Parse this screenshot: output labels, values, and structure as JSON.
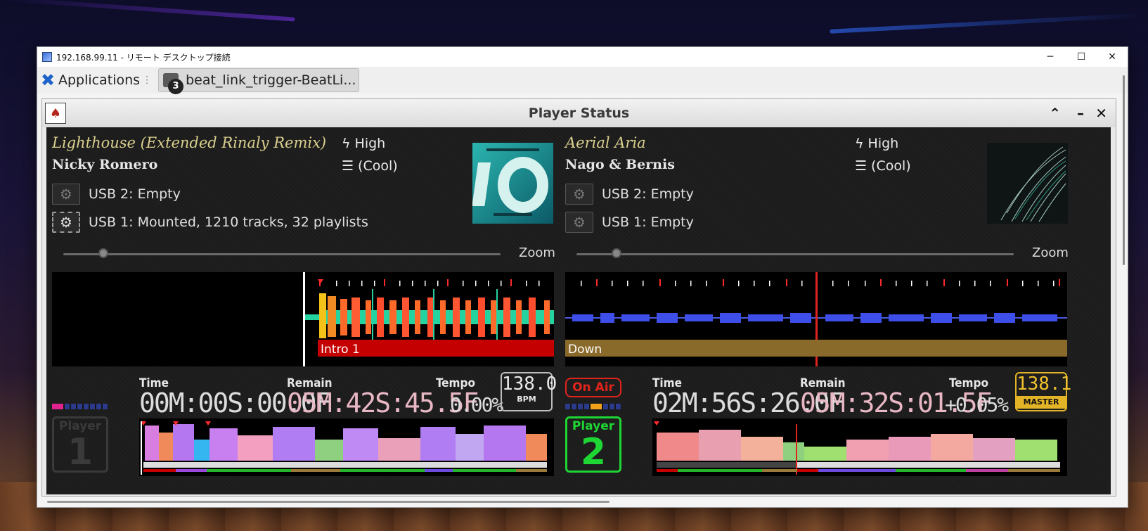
{
  "remote_window": {
    "title": "192.168.99.11 - リモート デスクトップ接続",
    "controls": {
      "minimize": "─",
      "maximize": "☐",
      "close": "✕"
    }
  },
  "panel": {
    "applications_label": "Applications",
    "task_label": "beat_link_trigger-BeatLi...",
    "task_badge": "3"
  },
  "player_status": {
    "title": "Player Status",
    "controls": {
      "collapse": "⌃",
      "minimize": "–",
      "close": "✕"
    }
  },
  "decks": [
    {
      "title": "Lighthouse (Extended Rinaly Remix)",
      "artist": "Nicky Romero",
      "energy": "High",
      "mood": "(Cool)",
      "usb2_label": "USB 2:",
      "usb2_status": "Empty",
      "usb1_label": "USB 1:",
      "usb1_status": "Mounted, 1210 tracks, 32 playlists",
      "zoom_label": "Zoom",
      "phrase_label": "Intro 1",
      "time_label": "Time",
      "time_value": "00M:00S:00.0F",
      "remain_label": "Remain",
      "remain_value": "05M:42S:45.5F",
      "tempo_label": "Tempo",
      "tempo_value": "0.00%",
      "bpm": "138.0",
      "bpm_sub": "BPM",
      "player_word": "Player",
      "player_number": "1",
      "on_air": false
    },
    {
      "title": "Aerial Aria",
      "artist": "Nago & Bernis",
      "energy": "High",
      "mood": "(Cool)",
      "usb2_label": "USB 2:",
      "usb2_status": "Empty",
      "usb1_label": "USB 1:",
      "usb1_status": "Empty",
      "zoom_label": "Zoom",
      "phrase_label": "Down",
      "time_label": "Time",
      "time_value": "02M:56S:26.0F",
      "remain_label": "Remain",
      "remain_value": "05M:32S:01.5F",
      "tempo_label": "Tempo",
      "tempo_value": "+0.05%",
      "bpm": "138.1",
      "bpm_sub": "MASTER",
      "on_air_label": "On Air",
      "player_word": "Player",
      "player_number": "2",
      "on_air": true
    }
  ],
  "icons": {
    "xfce": "xfce-icon",
    "energy": "lightning-icon",
    "mood": "sliders-icon",
    "usb": "gear-icon"
  },
  "colors": {
    "title_gold": "#d9cf8d",
    "on_air_red": "#e0241c",
    "player_active_green": "#1ed633",
    "master_yellow": "#e3b526",
    "intro_phrase": "#c40000",
    "down_phrase": "#8a6a2a"
  }
}
